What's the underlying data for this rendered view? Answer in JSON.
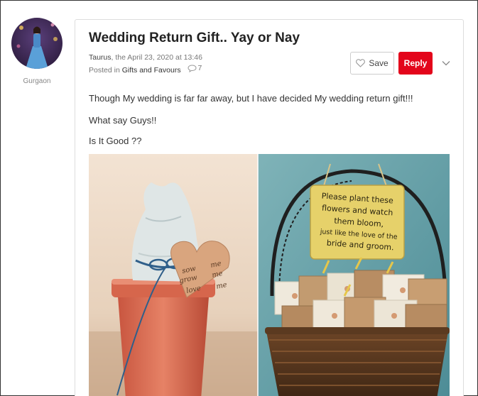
{
  "author": {
    "location": "Gurgaon"
  },
  "post": {
    "title": "Wedding Return Gift.. Yay or Nay",
    "username": "Taurus",
    "date_text": ", the April 23, 2020 at 13:46",
    "posted_in_label": "Posted in",
    "category": "Gifts and Favours",
    "comment_count": "7",
    "paragraphs": [
      "Though My wedding is far far away, but I have decided My wedding return gift!!!",
      "What say Guys!!",
      "Is It Good ??"
    ]
  },
  "actions": {
    "save_label": "Save",
    "reply_label": "Reply"
  },
  "image": {
    "sign_lines": [
      "Please plant these",
      "flowers and watch",
      "them bloom,",
      "just like the love of the",
      "bride and groom."
    ],
    "tag_left": [
      "sow",
      "grow",
      "love"
    ],
    "tag_right": [
      "me",
      "me",
      "me"
    ]
  },
  "colors": {
    "accent": "#e3051b"
  }
}
